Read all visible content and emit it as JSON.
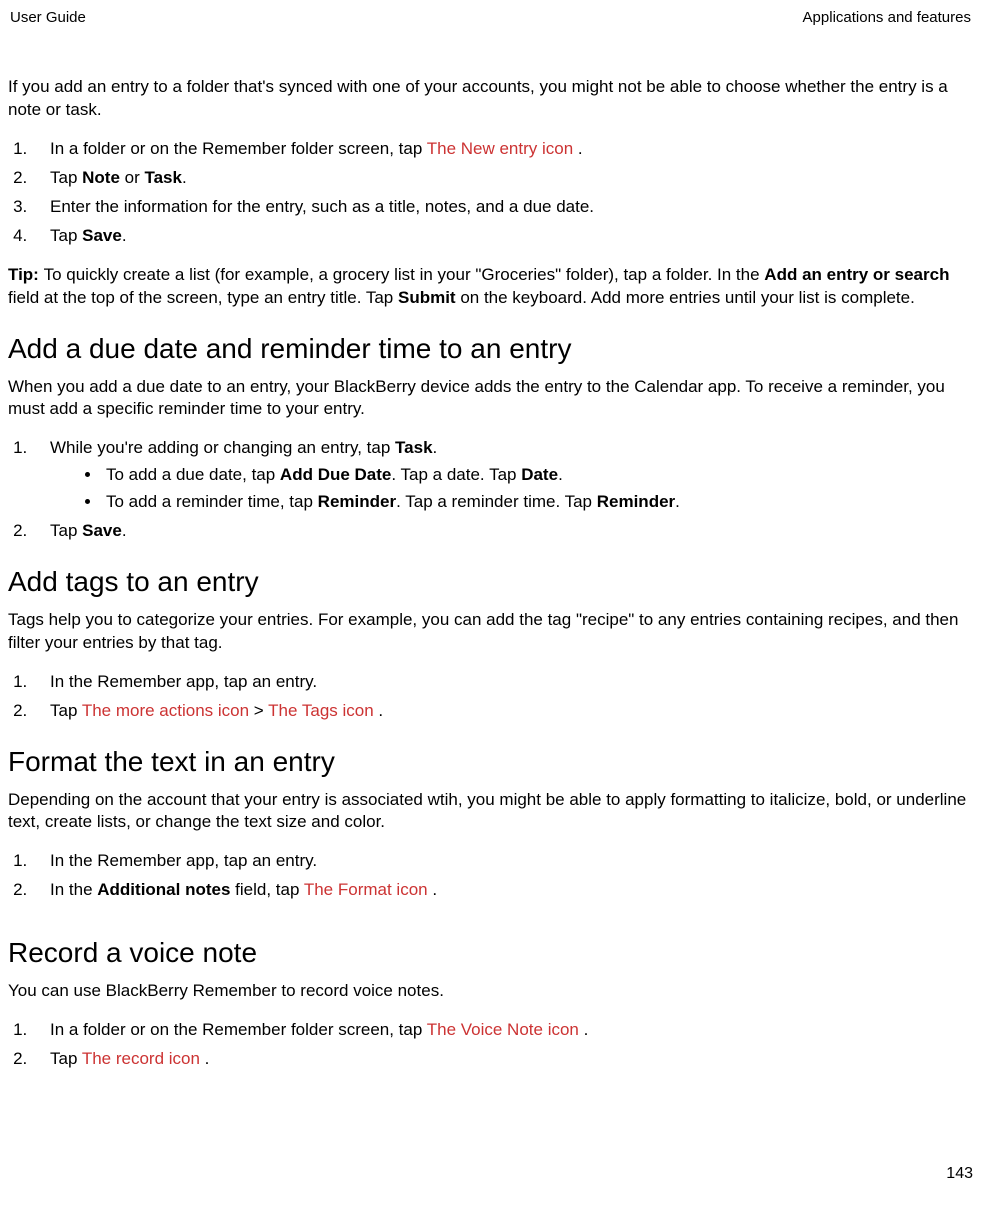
{
  "header": {
    "left": "User Guide",
    "right": "Applications and features"
  },
  "intro_para": "If you add an entry to a folder that's synced with one of your accounts, you might not be able to choose whether the entry is a note or task.",
  "steps1": {
    "s1_p1": "In a folder or on the Remember folder screen, tap  ",
    "s1_red": "The New entry icon",
    "s1_p2": " .",
    "s2_p1": "Tap ",
    "s2_b1": "Note",
    "s2_p2": " or ",
    "s2_b2": "Task",
    "s2_p3": ".",
    "s3": "Enter the information for the entry, such as a title, notes, and a due date.",
    "s4_p1": "Tap ",
    "s4_b1": "Save",
    "s4_p2": "."
  },
  "tip": {
    "label": "Tip: ",
    "t1": "To quickly create a list (for example, a grocery list in your \"Groceries\" folder), tap a folder. In the ",
    "b1": "Add an entry or search",
    "t2": " field at the top of the screen, type an entry title. Tap ",
    "b2": "Submit",
    "t3": " on the keyboard. Add more entries until your list is complete."
  },
  "h2_due": "Add a due date and reminder time to an entry",
  "due_para": "When you add a due date to an entry, your BlackBerry device adds the entry to the Calendar app. To receive a reminder, you must add a specific reminder time to your entry.",
  "due_steps": {
    "s1_p1": "While you're adding or changing an entry, tap ",
    "s1_b1": "Task",
    "s1_p2": ".",
    "b1_p1": "To add a due date, tap ",
    "b1_b1": "Add Due Date",
    "b1_p2": ". Tap a date. Tap ",
    "b1_b2": "Date",
    "b1_p3": ".",
    "b2_p1": "To add a reminder time, tap ",
    "b2_b1": "Reminder",
    "b2_p2": ". Tap a reminder time. Tap ",
    "b2_b2": "Reminder",
    "b2_p3": ".",
    "s2_p1": "Tap ",
    "s2_b1": "Save",
    "s2_p2": "."
  },
  "h2_tags": "Add tags to an entry",
  "tags_para": "Tags help you to categorize your entries. For example, you can add the tag \"recipe\" to any entries containing recipes, and then filter your entries by that tag.",
  "tags_steps": {
    "s1": "In the Remember app, tap an entry.",
    "s2_p1": "Tap  ",
    "s2_r1": "The more actions icon",
    "s2_p2": "  >  ",
    "s2_r2": "The Tags icon",
    "s2_p3": " ."
  },
  "h2_format": "Format the text in an entry",
  "format_para": "Depending on the account that your entry is associated wtih, you might be able to apply formatting to italicize, bold, or underline text, create lists, or change the text size and color.",
  "format_steps": {
    "s1": "In the Remember app, tap an entry.",
    "s2_p1": "In the ",
    "s2_b1": "Additional notes",
    "s2_p2": " field, tap  ",
    "s2_r1": "The Format icon",
    "s2_p3": " ."
  },
  "h2_voice": "Record a voice note",
  "voice_para": "You can use BlackBerry Remember to record voice notes.",
  "voice_steps": {
    "s1_p1": "In a folder or on the Remember folder screen, tap  ",
    "s1_r1": "The Voice Note icon",
    "s1_p2": " .",
    "s2_p1": "Tap  ",
    "s2_r1": "The record icon",
    "s2_p2": " ."
  },
  "page_number": "143"
}
